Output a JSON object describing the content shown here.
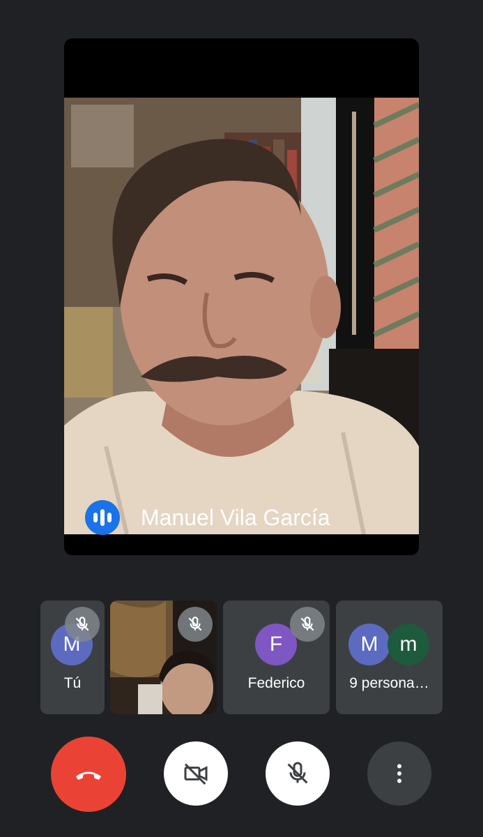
{
  "main_speaker": {
    "name": "Manuel Vila García",
    "speaking_indicator_icon": "audio-level-icon"
  },
  "participants": [
    {
      "label": "Tú",
      "initial": "M",
      "avatar_color": "#5c6bc0",
      "muted": true,
      "icon": "mic-off-icon"
    },
    {
      "label": "",
      "camera_on": true,
      "muted": true,
      "icon": "mic-off-icon"
    },
    {
      "label": "Federico",
      "initial": "F",
      "avatar_color": "#7e57c2",
      "muted": true,
      "icon": "mic-off-icon"
    },
    {
      "label": "9 persona…",
      "initials": [
        "M",
        "m"
      ],
      "avatar_colors": [
        "#5c6bc0",
        "#1e5a3c"
      ]
    }
  ],
  "controls": {
    "hangup": {
      "icon": "hang-up-icon",
      "color": "#ea4335"
    },
    "camera": {
      "icon": "camera-off-icon",
      "state": "off"
    },
    "microphone": {
      "icon": "mic-off-icon",
      "state": "off"
    },
    "more": {
      "icon": "more-vert-icon"
    }
  },
  "colors": {
    "background": "#202124",
    "tile": "#3c4043",
    "accent": "#1a73e8"
  }
}
